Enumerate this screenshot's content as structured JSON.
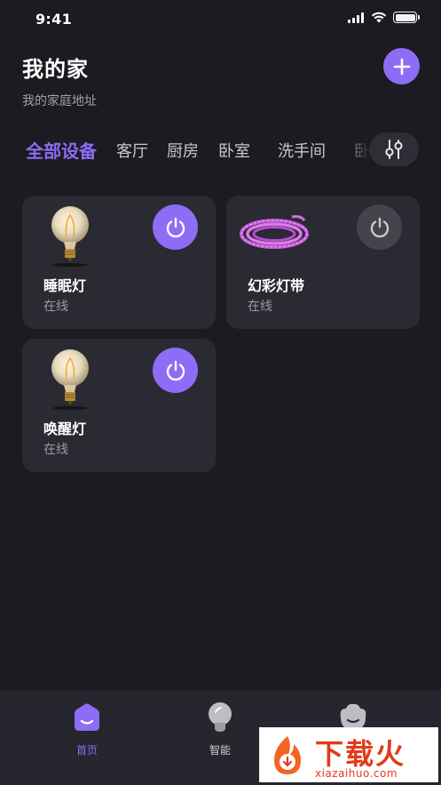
{
  "status_bar": {
    "time": "9:41"
  },
  "header": {
    "title": "我的家",
    "address": "我的家庭地址"
  },
  "tabs": [
    {
      "label": "全部设备",
      "active": true
    },
    {
      "label": "客厅",
      "active": false
    },
    {
      "label": "厨房",
      "active": false
    },
    {
      "label": "卧室",
      "active": false
    },
    {
      "label": "洗手间",
      "active": false
    },
    {
      "label": "卧",
      "active": false
    }
  ],
  "devices": [
    {
      "name": "睡眠灯",
      "status": "在线",
      "icon": "bulb-icon",
      "power": "on"
    },
    {
      "name": "幻彩灯带",
      "status": "在线",
      "icon": "led-strip-icon",
      "power": "off"
    },
    {
      "name": "唤醒灯",
      "status": "在线",
      "icon": "bulb-icon",
      "power": "on"
    }
  ],
  "bottom_nav": [
    {
      "label": "首页",
      "icon": "home-icon",
      "active": true
    },
    {
      "label": "智能",
      "icon": "smart-bulb-icon",
      "active": false
    },
    {
      "label": "",
      "icon": "profile-icon",
      "active": false
    }
  ],
  "watermark": {
    "text": "下载火",
    "url": "xiazaihuo.com"
  },
  "colors": {
    "accent": "#8e6cf5",
    "background": "#1b1b21",
    "card": "#2a2a32",
    "power_off": "#44444c"
  }
}
